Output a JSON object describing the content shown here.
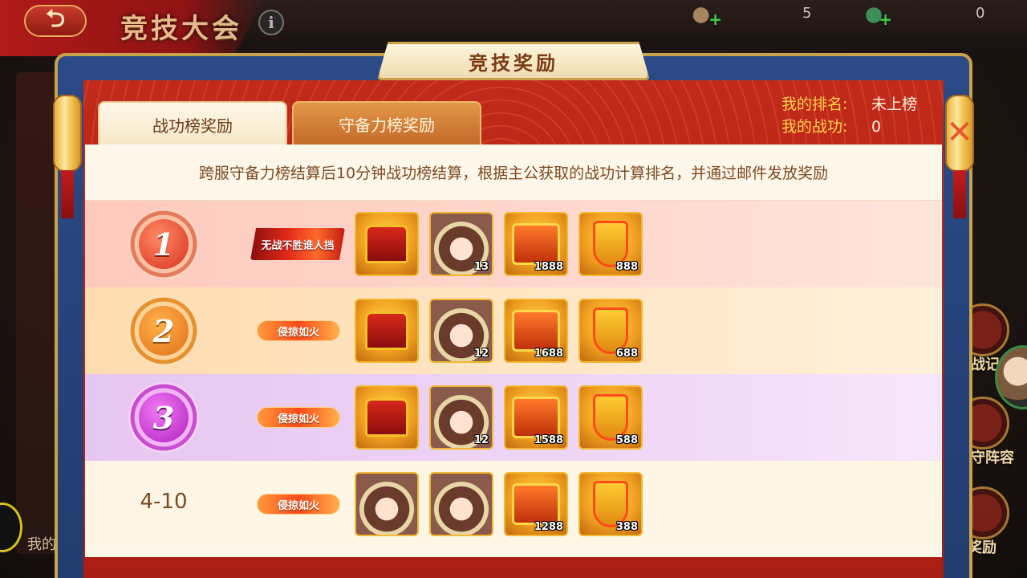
{
  "background": {
    "back_arrow": "⮌",
    "screen_title": "竞技大会",
    "info_glyph": "i",
    "resource_1_value": "5",
    "resource_2_value": "0",
    "right_menu_1": "挑战记录",
    "right_menu_2": "防守阵容",
    "right_menu_3": "奖励",
    "left_bottom": "我的"
  },
  "modal": {
    "title": "竞技奖励",
    "close_glyph": "✕",
    "tabs": [
      {
        "label": "战功榜奖励",
        "active": true
      },
      {
        "label": "守备力榜奖励",
        "active": false
      }
    ],
    "my_rank_label": "我的排名:",
    "my_rank_value": "未上榜",
    "my_merit_label": "我的战功:",
    "my_merit_value": "0",
    "notice": "跨服守备力榜结算后10分钟战功榜结算，根据主公获取的战功计算排名，并通过邮件发放奖励"
  },
  "rewards": [
    {
      "rank": "1",
      "title": "无战不胜谁人挡",
      "items": [
        {
          "icon": "treasure-chest-icon",
          "qty": ""
        },
        {
          "icon": "hero-portrait-icon",
          "qty": "13"
        },
        {
          "icon": "gift-box-icon",
          "qty": "1888"
        },
        {
          "icon": "token-icon",
          "qty": "888"
        }
      ]
    },
    {
      "rank": "2",
      "title": "侵掠如火",
      "items": [
        {
          "icon": "treasure-chest-icon",
          "qty": ""
        },
        {
          "icon": "hero-portrait-icon",
          "qty": "12"
        },
        {
          "icon": "gift-box-icon",
          "qty": "1688"
        },
        {
          "icon": "token-icon",
          "qty": "688"
        }
      ]
    },
    {
      "rank": "3",
      "title": "侵掠如火",
      "items": [
        {
          "icon": "treasure-chest-icon",
          "qty": ""
        },
        {
          "icon": "hero-portrait-icon",
          "qty": "12"
        },
        {
          "icon": "gift-box-icon",
          "qty": "1588"
        },
        {
          "icon": "token-icon",
          "qty": "588"
        }
      ]
    },
    {
      "rank": "4-10",
      "title": "侵掠如火",
      "items": [
        {
          "icon": "hero-portrait-icon",
          "qty": ""
        },
        {
          "icon": "hero-portrait-icon",
          "qty": ""
        },
        {
          "icon": "gift-box-icon",
          "qty": "1288"
        },
        {
          "icon": "token-icon",
          "qty": "388"
        }
      ]
    }
  ],
  "colors": {
    "accent_gold": "#ffd24a",
    "modal_red": "#c12a1a",
    "panel_bg": "#fff8ea"
  }
}
